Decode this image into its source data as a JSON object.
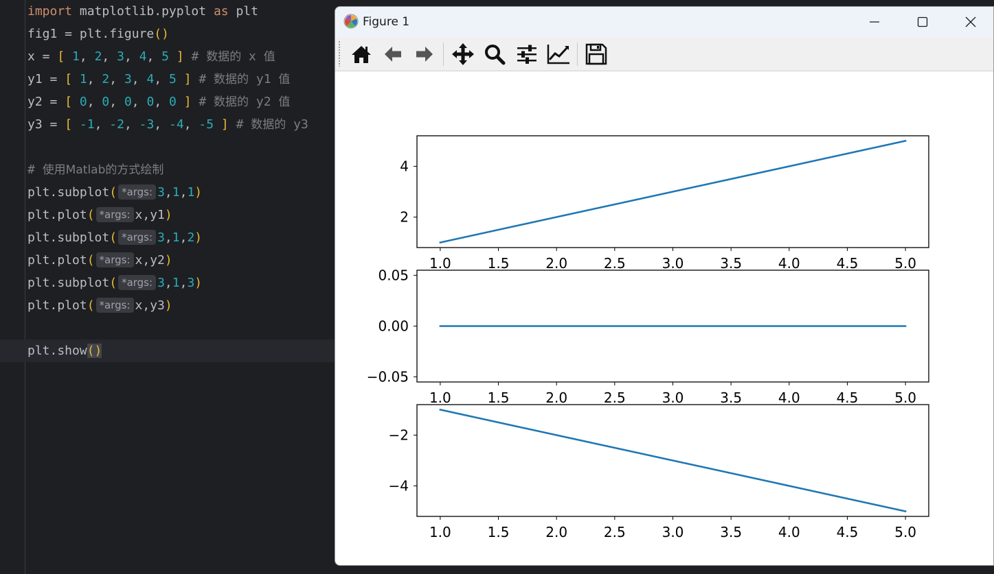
{
  "editor": {
    "lines": [
      [
        {
          "t": "import",
          "c": "kw"
        },
        {
          "t": " matplotlib.pyplot "
        },
        {
          "t": "as",
          "c": "kw"
        },
        {
          "t": " plt"
        }
      ],
      [
        {
          "t": "fig1 = plt.figure"
        },
        {
          "t": "()",
          "c": "br"
        }
      ],
      [
        {
          "t": "x = "
        },
        {
          "t": "[",
          "c": "br"
        },
        {
          "t": " "
        },
        {
          "t": "1",
          "c": "num"
        },
        {
          "t": ", "
        },
        {
          "t": "2",
          "c": "num"
        },
        {
          "t": ", "
        },
        {
          "t": "3",
          "c": "num"
        },
        {
          "t": ", "
        },
        {
          "t": "4",
          "c": "num"
        },
        {
          "t": ", "
        },
        {
          "t": "5",
          "c": "num"
        },
        {
          "t": " "
        },
        {
          "t": "]",
          "c": "br"
        },
        {
          "t": " # ",
          "c": "cm"
        },
        {
          "t": "数据的",
          "c": "cm-cn"
        },
        {
          "t": " x ",
          "c": "cm"
        },
        {
          "t": "值",
          "c": "cm-cn"
        }
      ],
      [
        {
          "t": "y1 = "
        },
        {
          "t": "[",
          "c": "br"
        },
        {
          "t": " "
        },
        {
          "t": "1",
          "c": "num"
        },
        {
          "t": ", "
        },
        {
          "t": "2",
          "c": "num"
        },
        {
          "t": ", "
        },
        {
          "t": "3",
          "c": "num"
        },
        {
          "t": ", "
        },
        {
          "t": "4",
          "c": "num"
        },
        {
          "t": ", "
        },
        {
          "t": "5",
          "c": "num"
        },
        {
          "t": " "
        },
        {
          "t": "]",
          "c": "br"
        },
        {
          "t": " # ",
          "c": "cm"
        },
        {
          "t": "数据的",
          "c": "cm-cn"
        },
        {
          "t": " y1 ",
          "c": "cm"
        },
        {
          "t": "值",
          "c": "cm-cn"
        }
      ],
      [
        {
          "t": "y2 = "
        },
        {
          "t": "[",
          "c": "br"
        },
        {
          "t": " "
        },
        {
          "t": "0",
          "c": "num"
        },
        {
          "t": ", "
        },
        {
          "t": "0",
          "c": "num"
        },
        {
          "t": ", "
        },
        {
          "t": "0",
          "c": "num"
        },
        {
          "t": ", "
        },
        {
          "t": "0",
          "c": "num"
        },
        {
          "t": ", "
        },
        {
          "t": "0",
          "c": "num"
        },
        {
          "t": " "
        },
        {
          "t": "]",
          "c": "br"
        },
        {
          "t": " # ",
          "c": "cm"
        },
        {
          "t": "数据的",
          "c": "cm-cn"
        },
        {
          "t": " y2 ",
          "c": "cm"
        },
        {
          "t": "值",
          "c": "cm-cn"
        }
      ],
      [
        {
          "t": "y3 = "
        },
        {
          "t": "[",
          "c": "br"
        },
        {
          "t": " "
        },
        {
          "t": "-1",
          "c": "num"
        },
        {
          "t": ", "
        },
        {
          "t": "-2",
          "c": "num"
        },
        {
          "t": ", "
        },
        {
          "t": "-3",
          "c": "num"
        },
        {
          "t": ", "
        },
        {
          "t": "-4",
          "c": "num"
        },
        {
          "t": ", "
        },
        {
          "t": "-5",
          "c": "num"
        },
        {
          "t": " "
        },
        {
          "t": "]",
          "c": "br"
        },
        {
          "t": " # ",
          "c": "cm"
        },
        {
          "t": "数据的",
          "c": "cm-cn"
        },
        {
          "t": " y3",
          "c": "cm"
        }
      ],
      [],
      [
        {
          "t": "# ",
          "c": "cm"
        },
        {
          "t": "使用Matlab的方式绘制",
          "c": "cm-cn"
        }
      ],
      [
        {
          "t": "plt.subplot"
        },
        {
          "t": "(",
          "c": "br"
        },
        {
          "t": "*args:",
          "c": "hint"
        },
        {
          "t": "3",
          "c": "num"
        },
        {
          "t": ","
        },
        {
          "t": "1",
          "c": "num"
        },
        {
          "t": ","
        },
        {
          "t": "1",
          "c": "num"
        },
        {
          "t": ")",
          "c": "br"
        }
      ],
      [
        {
          "t": "plt.plot"
        },
        {
          "t": "(",
          "c": "br"
        },
        {
          "t": "*args:",
          "c": "hint"
        },
        {
          "t": "x,y1"
        },
        {
          "t": ")",
          "c": "br"
        }
      ],
      [
        {
          "t": "plt.subplot"
        },
        {
          "t": "(",
          "c": "br"
        },
        {
          "t": "*args:",
          "c": "hint"
        },
        {
          "t": "3",
          "c": "num"
        },
        {
          "t": ","
        },
        {
          "t": "1",
          "c": "num"
        },
        {
          "t": ","
        },
        {
          "t": "2",
          "c": "num"
        },
        {
          "t": ")",
          "c": "br"
        }
      ],
      [
        {
          "t": "plt.plot"
        },
        {
          "t": "(",
          "c": "br"
        },
        {
          "t": "*args:",
          "c": "hint"
        },
        {
          "t": "x,y2"
        },
        {
          "t": ")",
          "c": "br"
        }
      ],
      [
        {
          "t": "plt.subplot"
        },
        {
          "t": "(",
          "c": "br"
        },
        {
          "t": "*args:",
          "c": "hint"
        },
        {
          "t": "3",
          "c": "num"
        },
        {
          "t": ","
        },
        {
          "t": "1",
          "c": "num"
        },
        {
          "t": ","
        },
        {
          "t": "3",
          "c": "num"
        },
        {
          "t": ")",
          "c": "br"
        }
      ],
      [
        {
          "t": "plt.plot"
        },
        {
          "t": "(",
          "c": "br"
        },
        {
          "t": "*args:",
          "c": "hint"
        },
        {
          "t": "x,y3"
        },
        {
          "t": ")",
          "c": "br"
        }
      ],
      [],
      [
        {
          "t": "plt.show"
        },
        {
          "t": "()",
          "c": "br match"
        }
      ]
    ],
    "colors": {
      "background": "#1e1f22",
      "keyword": "#cf8e6d",
      "number": "#2aacb8",
      "bracket": "#e8ba36",
      "comment": "#7a7e85",
      "text": "#bcbec4"
    }
  },
  "window": {
    "title": "Figure 1",
    "icons": {
      "app": "matplotlib-logo-icon",
      "minimize": "minimize-icon",
      "maximize": "maximize-icon",
      "close": "close-icon"
    }
  },
  "toolbar": {
    "buttons": [
      "home-icon",
      "back-arrow-icon",
      "forward-arrow-icon",
      "pan-move-icon",
      "zoom-magnifier-icon",
      "configure-subplots-icon",
      "edit-axis-icon",
      "save-floppy-icon"
    ]
  },
  "chart_data": [
    {
      "type": "line",
      "x": [
        1,
        2,
        3,
        4,
        5
      ],
      "series": [
        {
          "values": [
            1,
            2,
            3,
            4,
            5
          ],
          "color": "#1f77b4"
        }
      ],
      "xlim": [
        0.8,
        5.2
      ],
      "ylim": [
        0.8,
        5.2
      ],
      "xticks": [
        1.0,
        1.5,
        2.0,
        2.5,
        3.0,
        3.5,
        4.0,
        4.5,
        5.0
      ],
      "xtick_labels": [
        "1.0",
        "1.5",
        "2.0",
        "2.5",
        "3.0",
        "3.5",
        "4.0",
        "4.5",
        "5.0"
      ],
      "yticks": [
        2,
        4
      ],
      "ytick_labels": [
        "2",
        "4"
      ],
      "grid": false
    },
    {
      "type": "line",
      "x": [
        1,
        2,
        3,
        4,
        5
      ],
      "series": [
        {
          "values": [
            0,
            0,
            0,
            0,
            0
          ],
          "color": "#1f77b4"
        }
      ],
      "xlim": [
        0.8,
        5.2
      ],
      "ylim": [
        -0.055,
        0.055
      ],
      "xticks": [
        1.0,
        1.5,
        2.0,
        2.5,
        3.0,
        3.5,
        4.0,
        4.5,
        5.0
      ],
      "xtick_labels": [
        "1.0",
        "1.5",
        "2.0",
        "2.5",
        "3.0",
        "3.5",
        "4.0",
        "4.5",
        "5.0"
      ],
      "yticks": [
        -0.05,
        0.0,
        0.05
      ],
      "ytick_labels": [
        "−0.05",
        "0.00",
        "0.05"
      ],
      "grid": false
    },
    {
      "type": "line",
      "x": [
        1,
        2,
        3,
        4,
        5
      ],
      "series": [
        {
          "values": [
            -1,
            -2,
            -3,
            -4,
            -5
          ],
          "color": "#1f77b4"
        }
      ],
      "xlim": [
        0.8,
        5.2
      ],
      "ylim": [
        -5.2,
        -0.8
      ],
      "xticks": [
        1.0,
        1.5,
        2.0,
        2.5,
        3.0,
        3.5,
        4.0,
        4.5,
        5.0
      ],
      "xtick_labels": [
        "1.0",
        "1.5",
        "2.0",
        "2.5",
        "3.0",
        "3.5",
        "4.0",
        "4.5",
        "5.0"
      ],
      "yticks": [
        -4,
        -2
      ],
      "ytick_labels": [
        "−4",
        "−2"
      ],
      "grid": false
    }
  ]
}
